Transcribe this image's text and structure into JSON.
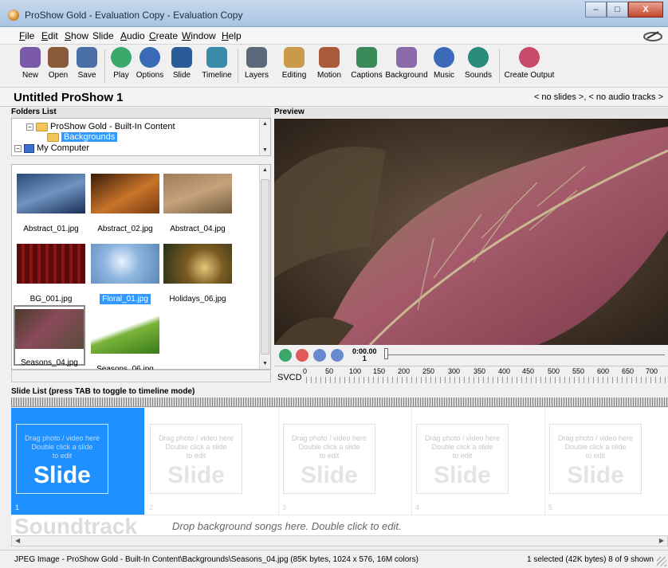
{
  "window": {
    "title": "ProShow Gold - Evaluation Copy - Evaluation Copy",
    "min_glyph": "–",
    "max_glyph": "□",
    "close_glyph": "X"
  },
  "menu": {
    "items": [
      {
        "key": "F",
        "rest": "ile"
      },
      {
        "key": "E",
        "rest": "dit"
      },
      {
        "key": "S",
        "rest": "how"
      },
      {
        "key": "Sl",
        "rest": "ide",
        "underline_second": true
      },
      {
        "key": "A",
        "rest": "udio"
      },
      {
        "key": "C",
        "rest": "reate"
      },
      {
        "key": "W",
        "rest": "indow"
      },
      {
        "key": "H",
        "rest": "elp"
      }
    ],
    "labels": [
      "File",
      "Edit",
      "Show",
      "Slide",
      "Audio",
      "Create",
      "Window",
      "Help"
    ]
  },
  "toolbar": {
    "buttons": [
      "New",
      "Open",
      "Save",
      "Play",
      "Options",
      "Slide",
      "Timeline",
      "Layers",
      "Editing",
      "Motion",
      "Captions",
      "Background",
      "Music",
      "Sounds",
      "Create Output"
    ],
    "colors": [
      "#7a5aa8",
      "#8a5a3a",
      "#4a6fa8",
      "#3aa86a",
      "#3a6ab8",
      "#2a5a98",
      "#3a8aaa",
      "#5a6a7a",
      "#c89a4a",
      "#a85a3a",
      "#3a8a5a",
      "#8a6aa8",
      "#3a6ab8",
      "#2a8a7a",
      "#c84a6a"
    ]
  },
  "project": {
    "name": "Untitled ProShow 1",
    "info": "< no slides >, < no audio tracks >"
  },
  "folders": {
    "header": "Folders List",
    "tree": [
      {
        "label": "ProShow Gold - Built-In Content",
        "expander": "−"
      },
      {
        "label": "Backgrounds",
        "selected": true
      },
      {
        "label": "My Computer",
        "expander": "−"
      }
    ]
  },
  "files": [
    {
      "name": "Abstract_01.jpg",
      "bg": "linear-gradient(160deg,#2b4a78,#6f94c2 50%,#1a2e55)"
    },
    {
      "name": "Abstract_02.jpg",
      "bg": "linear-gradient(150deg,#3a1c08,#c9742a 55%,#7a3a12)"
    },
    {
      "name": "Abstract_04.jpg",
      "bg": "linear-gradient(160deg,#a07a5a,#c7a27c 50%,#6e5a3c)"
    },
    {
      "name": "BG_001.jpg",
      "bg": "repeating-linear-gradient(90deg,#5a0a0a 0 6px,#8a1414 6px 10px)"
    },
    {
      "name": "Floral_01.jpg",
      "bg": "radial-gradient(circle at 45% 45%,#e8f2ff,#8fb6df 40%,#5a86b8)",
      "selected": true
    },
    {
      "name": "Holidays_06.jpg",
      "bg": "radial-gradient(circle at 60% 60%,#e6c67a,#7a5a22 40%,#24301a)"
    },
    {
      "name": "Seasons_04.jpg",
      "bg": "linear-gradient(135deg,#4a3a2a,#8a4a5a 45%,#5a4a3a)",
      "framed": true
    },
    {
      "name": "Seasons_06.jpg",
      "bg": "linear-gradient(160deg,#ffffff 40%,#7ab43a 50%,#3a7a1a)"
    }
  ],
  "preview": {
    "header": "Preview",
    "time": "0:00.00",
    "frame": "1",
    "format": "SVCD",
    "ruler_labels": [
      "0",
      "50",
      "100",
      "150",
      "200",
      "250",
      "300",
      "350",
      "400",
      "450",
      "500",
      "550",
      "600",
      "650",
      "700"
    ]
  },
  "slidelist": {
    "header": "Slide List (press TAB to toggle to timeline mode)",
    "slides": [
      {
        "num": "1",
        "hint": [
          "Drag photo / video here",
          "Double click a slide",
          "to edit"
        ],
        "word": "Slide",
        "active": true
      },
      {
        "num": "2",
        "hint": [
          "Drag photo / video here",
          "Double click a slide",
          "to edit"
        ],
        "word": "Slide"
      },
      {
        "num": "3",
        "hint": [
          "Drag photo / video here",
          "Double click a slide",
          "to edit"
        ],
        "word": "Slide"
      },
      {
        "num": "4",
        "hint": [
          "Drag photo / video here",
          "Double click a slide",
          "to edit"
        ],
        "word": "Slide"
      },
      {
        "num": "5",
        "hint": [
          "Drag photo / video here",
          "Double click a slide",
          "to edit"
        ],
        "word": "Slide"
      }
    ],
    "soundtrack_word": "Soundtrack",
    "soundtrack_msg": "Drop background songs here.  Double click to edit."
  },
  "status": {
    "left": "JPEG Image - ProShow Gold - Built-In Content\\Backgrounds\\Seasons_04.jpg  (85K bytes, 1024 x 576, 16M colors)",
    "right": "1 selected (42K bytes) 8 of 9 shown"
  }
}
